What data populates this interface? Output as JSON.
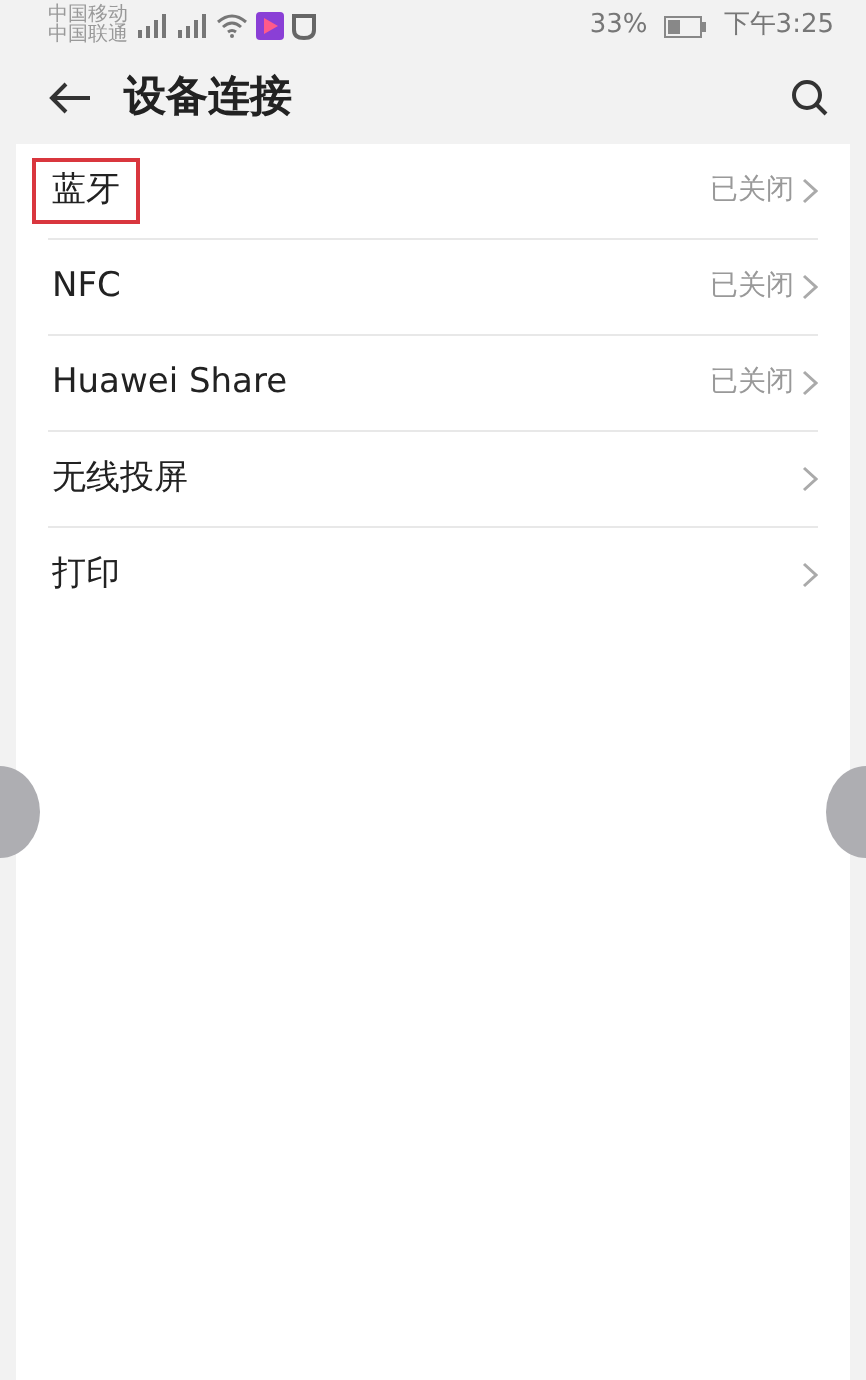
{
  "status_bar": {
    "carriers": [
      "中国移动",
      "中国联通"
    ],
    "battery": "33%",
    "time": "下午3:25"
  },
  "header": {
    "title": "设备连接"
  },
  "items": [
    {
      "label": "蓝牙",
      "value": "已关闭",
      "highlighted": true
    },
    {
      "label": "NFC",
      "value": "已关闭",
      "highlighted": false
    },
    {
      "label": "Huawei Share",
      "value": "已关闭",
      "highlighted": false
    },
    {
      "label": "无线投屏",
      "highlighted": false
    },
    {
      "label": "打印",
      "highlighted": false
    }
  ]
}
